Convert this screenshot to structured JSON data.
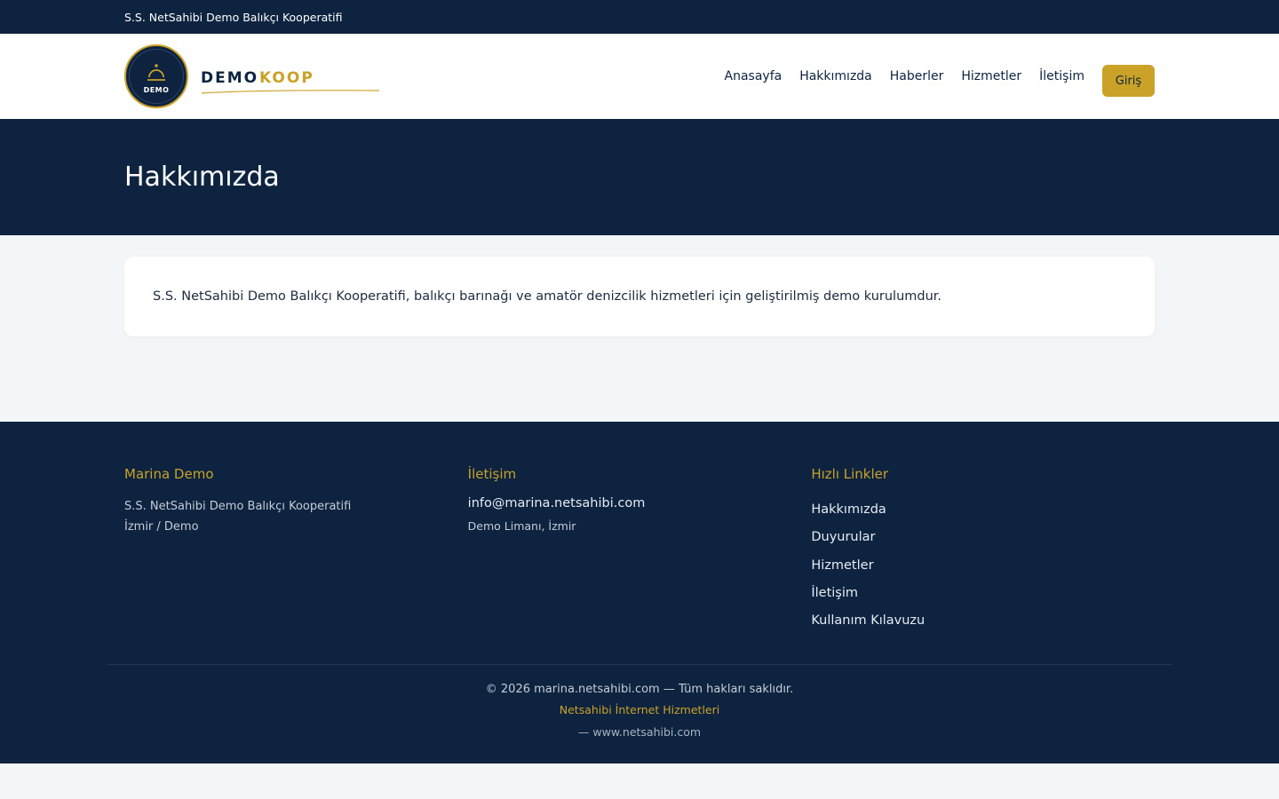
{
  "topbar": {
    "org_name": "S.S. NetSahibi Demo Balıkçı Kooperatifi"
  },
  "brand": {
    "badge_text": "DEMO",
    "word1": "DEMO",
    "word2": "KOOP",
    "accent_color": "#c9a227",
    "navy_color": "#0d2340"
  },
  "nav": {
    "items": [
      "Anasayfa",
      "Hakkımızda",
      "Haberler",
      "Hizmetler",
      "İletişim"
    ],
    "login_label": "Giriş"
  },
  "hero": {
    "title": "Hakkımızda"
  },
  "content": {
    "text": "S.S. NetSahibi Demo Balıkçı Kooperatifi, balıkçı barınağı ve amatör denizcilik hizmetleri için geliştirilmiş demo kurulumdur."
  },
  "footer": {
    "col1": {
      "heading": "Marina Demo",
      "line1": "S.S. NetSahibi Demo Balıkçı Kooperatifi",
      "line2": "İzmir / Demo"
    },
    "col2": {
      "heading": "İletişim",
      "email": "info@marina.netsahibi.com",
      "address": "Demo Limanı, İzmir"
    },
    "col3": {
      "heading": "Hızlı Linkler",
      "links": [
        "Hakkımızda",
        "Duyurular",
        "Hizmetler",
        "İletişim",
        "Kullanım Kılavuzu"
      ]
    },
    "copyright": "© 2026 marina.netsahibi.com — Tüm hakları saklıdır.",
    "provider": "Netsahibi İnternet Hizmetleri",
    "site": "— www.netsahibi.com"
  }
}
